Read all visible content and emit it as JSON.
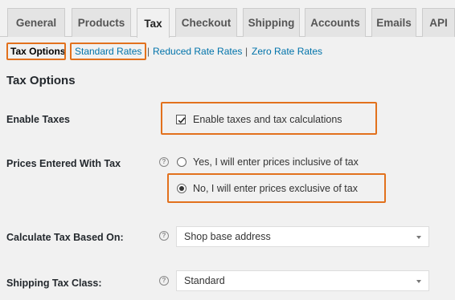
{
  "tabs": [
    {
      "label": "General",
      "active": false
    },
    {
      "label": "Products",
      "active": false
    },
    {
      "label": "Tax",
      "active": true
    },
    {
      "label": "Checkout",
      "active": false
    },
    {
      "label": "Shipping",
      "active": false
    },
    {
      "label": "Accounts",
      "active": false
    },
    {
      "label": "Emails",
      "active": false
    },
    {
      "label": "API",
      "active": false
    }
  ],
  "subnav": {
    "current": "Tax Options",
    "links": [
      "Standard Rates",
      "Reduced Rate Rates",
      "Zero Rate Rates"
    ],
    "separator": "|"
  },
  "section_title": "Tax Options",
  "enable_taxes": {
    "label": "Enable Taxes",
    "checkbox_label": "Enable taxes and tax calculations",
    "checked": true
  },
  "prices_entered": {
    "label": "Prices Entered With Tax",
    "help_icon": "question-circle-icon",
    "options": [
      {
        "label": "Yes, I will enter prices inclusive of tax",
        "selected": false
      },
      {
        "label": "No, I will enter prices exclusive of tax",
        "selected": true
      }
    ]
  },
  "calculate_based_on": {
    "label": "Calculate Tax Based On:",
    "help_icon": "question-circle-icon",
    "value": "Shop base address"
  },
  "shipping_tax_class": {
    "label": "Shipping Tax Class:",
    "help_icon": "question-circle-icon",
    "value": "Standard"
  },
  "colors": {
    "highlight": "#e2711d",
    "link": "#0073aa",
    "background": "#f1f1f1"
  }
}
